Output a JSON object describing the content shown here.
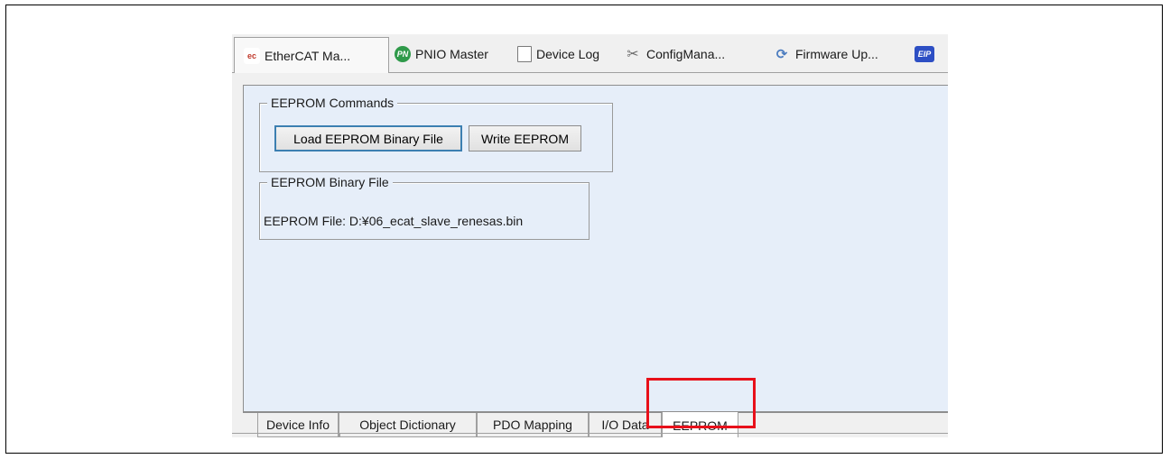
{
  "top_tabs": [
    {
      "label": "EtherCAT Ma...",
      "icon": "ethercat-icon",
      "icon_text": "ec"
    },
    {
      "label": "PNIO Master",
      "icon": "pnio-icon",
      "icon_text": "PN"
    },
    {
      "label": "Device Log",
      "icon": "clipboard-icon",
      "icon_text": ""
    },
    {
      "label": "ConfigMana...",
      "icon": "tools-icon",
      "icon_text": "✂"
    },
    {
      "label": "Firmware Up...",
      "icon": "firmware-update-icon",
      "icon_text": "⟳"
    },
    {
      "label": "",
      "icon": "eip-icon",
      "icon_text": "EIP"
    }
  ],
  "eeprom_commands": {
    "title": "EEPROM Commands",
    "load_button": "Load EEPROM Binary File",
    "write_button": "Write EEPROM"
  },
  "eeprom_binary": {
    "title": "EEPROM Binary File",
    "file_label": "EEPROM File:",
    "file_value": "D:¥06_ecat_slave_renesas.bin"
  },
  "bottom_tabs": [
    {
      "label": "Device Info"
    },
    {
      "label": "Object Dictionary"
    },
    {
      "label": "PDO Mapping"
    },
    {
      "label": "I/O Data"
    },
    {
      "label": "EEPROM"
    }
  ],
  "colors": {
    "panel_bg": "#e6eef9",
    "highlight": "#e8101a",
    "focus_border": "#3c7fb1"
  }
}
